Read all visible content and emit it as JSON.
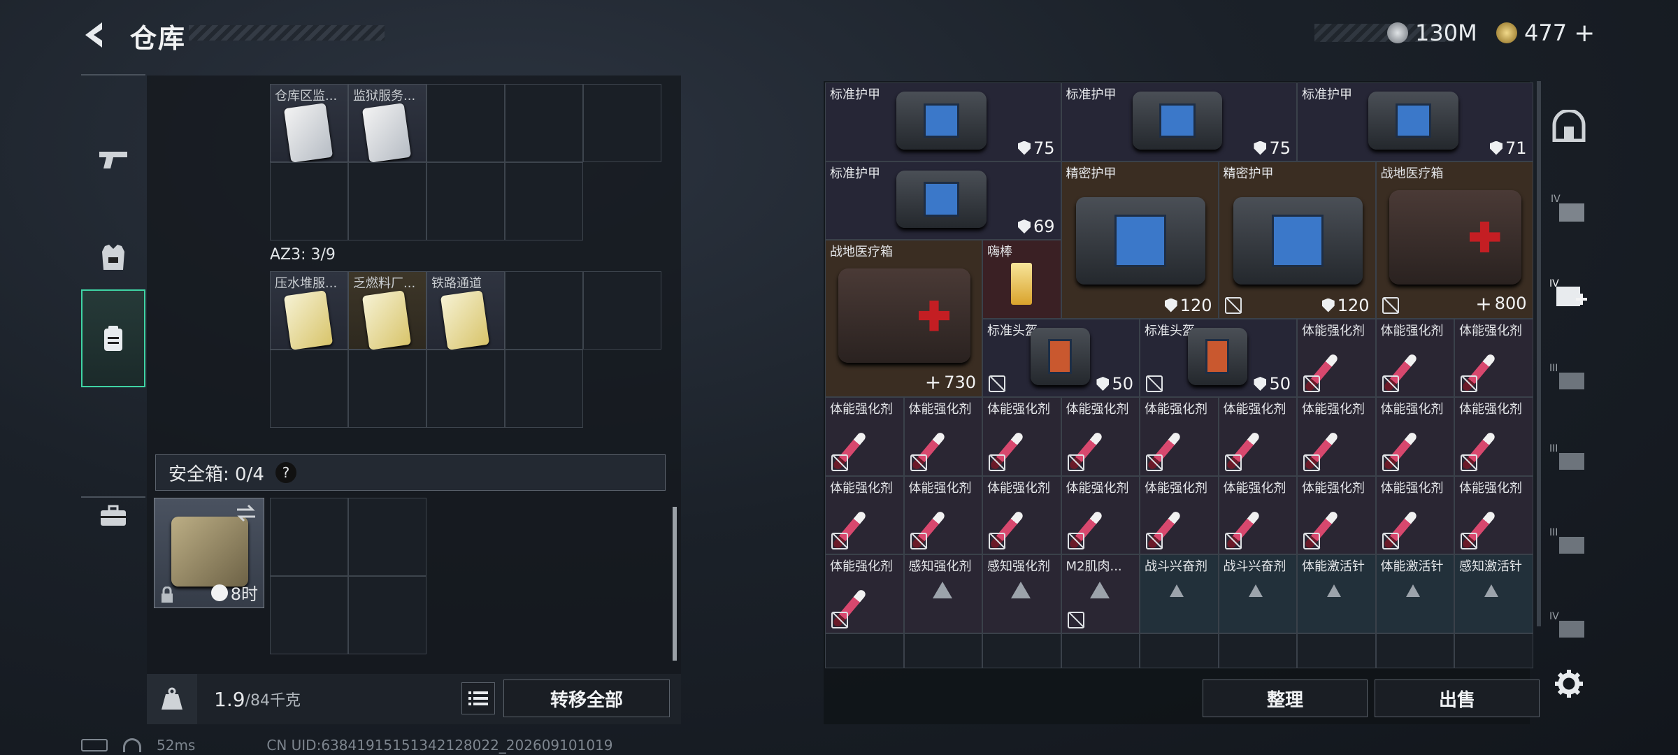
{
  "header": {
    "title": "仓库"
  },
  "currency": {
    "silver": "130M",
    "gold": "477"
  },
  "left_nav": [
    "weapon",
    "armor",
    "backpack",
    "briefcase"
  ],
  "left_grid": {
    "top_items": [
      {
        "label": "仓库区监..."
      },
      {
        "label": "监狱服务..."
      }
    ],
    "az3_label": "AZ3: 3/9",
    "az3_items": [
      {
        "label": "压水堆服..."
      },
      {
        "label": "乏燃料厂..."
      },
      {
        "label": "铁路通道"
      }
    ]
  },
  "safe_box": {
    "label": "安全箱: 0/4",
    "help": "?",
    "timer": "8时"
  },
  "weight": {
    "current": "1.9",
    "max": "/84千克"
  },
  "buttons": {
    "transfer_all": "转移全部",
    "organize": "整理",
    "sell": "出售"
  },
  "stash_items": [
    {
      "name": "标准护甲",
      "value": "75"
    },
    {
      "name": "标准护甲",
      "value": "75"
    },
    {
      "name": "标准护甲",
      "value": "71"
    },
    {
      "name": "标准护甲",
      "value": "69"
    },
    {
      "name": "精密护甲",
      "value": "120"
    },
    {
      "name": "精密护甲",
      "value": "120"
    },
    {
      "name": "战地医疗箱",
      "value": "800"
    },
    {
      "name": "战地医疗箱",
      "value": "730"
    },
    {
      "name": "嗨棒",
      "value": ""
    },
    {
      "name": "标准头盔",
      "value": "50"
    },
    {
      "name": "标准头盔",
      "value": "50"
    },
    {
      "name": "体能强化剂"
    },
    {
      "name": "体能强化剂"
    },
    {
      "name": "体能强化剂"
    },
    {
      "name": "体能强化剂"
    },
    {
      "name": "体能强化剂"
    },
    {
      "name": "体能强化剂"
    },
    {
      "name": "体能强化剂"
    },
    {
      "name": "体能强化剂"
    },
    {
      "name": "体能强化剂"
    },
    {
      "name": "体能强化剂"
    },
    {
      "name": "体能强化剂"
    },
    {
      "name": "体能强化剂"
    },
    {
      "name": "体能强化剂"
    },
    {
      "name": "体能强化剂"
    },
    {
      "name": "体能强化剂"
    },
    {
      "name": "体能强化剂"
    },
    {
      "name": "体能强化剂"
    },
    {
      "name": "体能强化剂"
    },
    {
      "name": "体能强化剂"
    },
    {
      "name": "体能强化剂"
    },
    {
      "name": "体能强化剂"
    },
    {
      "name": "体能强化剂"
    },
    {
      "name": "感知强化剂"
    },
    {
      "name": "感知强化剂"
    },
    {
      "name": "M2肌肉..."
    },
    {
      "name": "战斗兴奋剂"
    },
    {
      "name": "战斗兴奋剂"
    },
    {
      "name": "体能激活针"
    },
    {
      "name": "体能激活针"
    },
    {
      "name": "感知激活针"
    }
  ],
  "status": {
    "ping": "52ms",
    "uid": "CN UID:6384191515134212802​2_202609101019"
  },
  "right_nav": [
    "map",
    "IV",
    "IV+",
    "III",
    "III",
    "III",
    "IV"
  ]
}
